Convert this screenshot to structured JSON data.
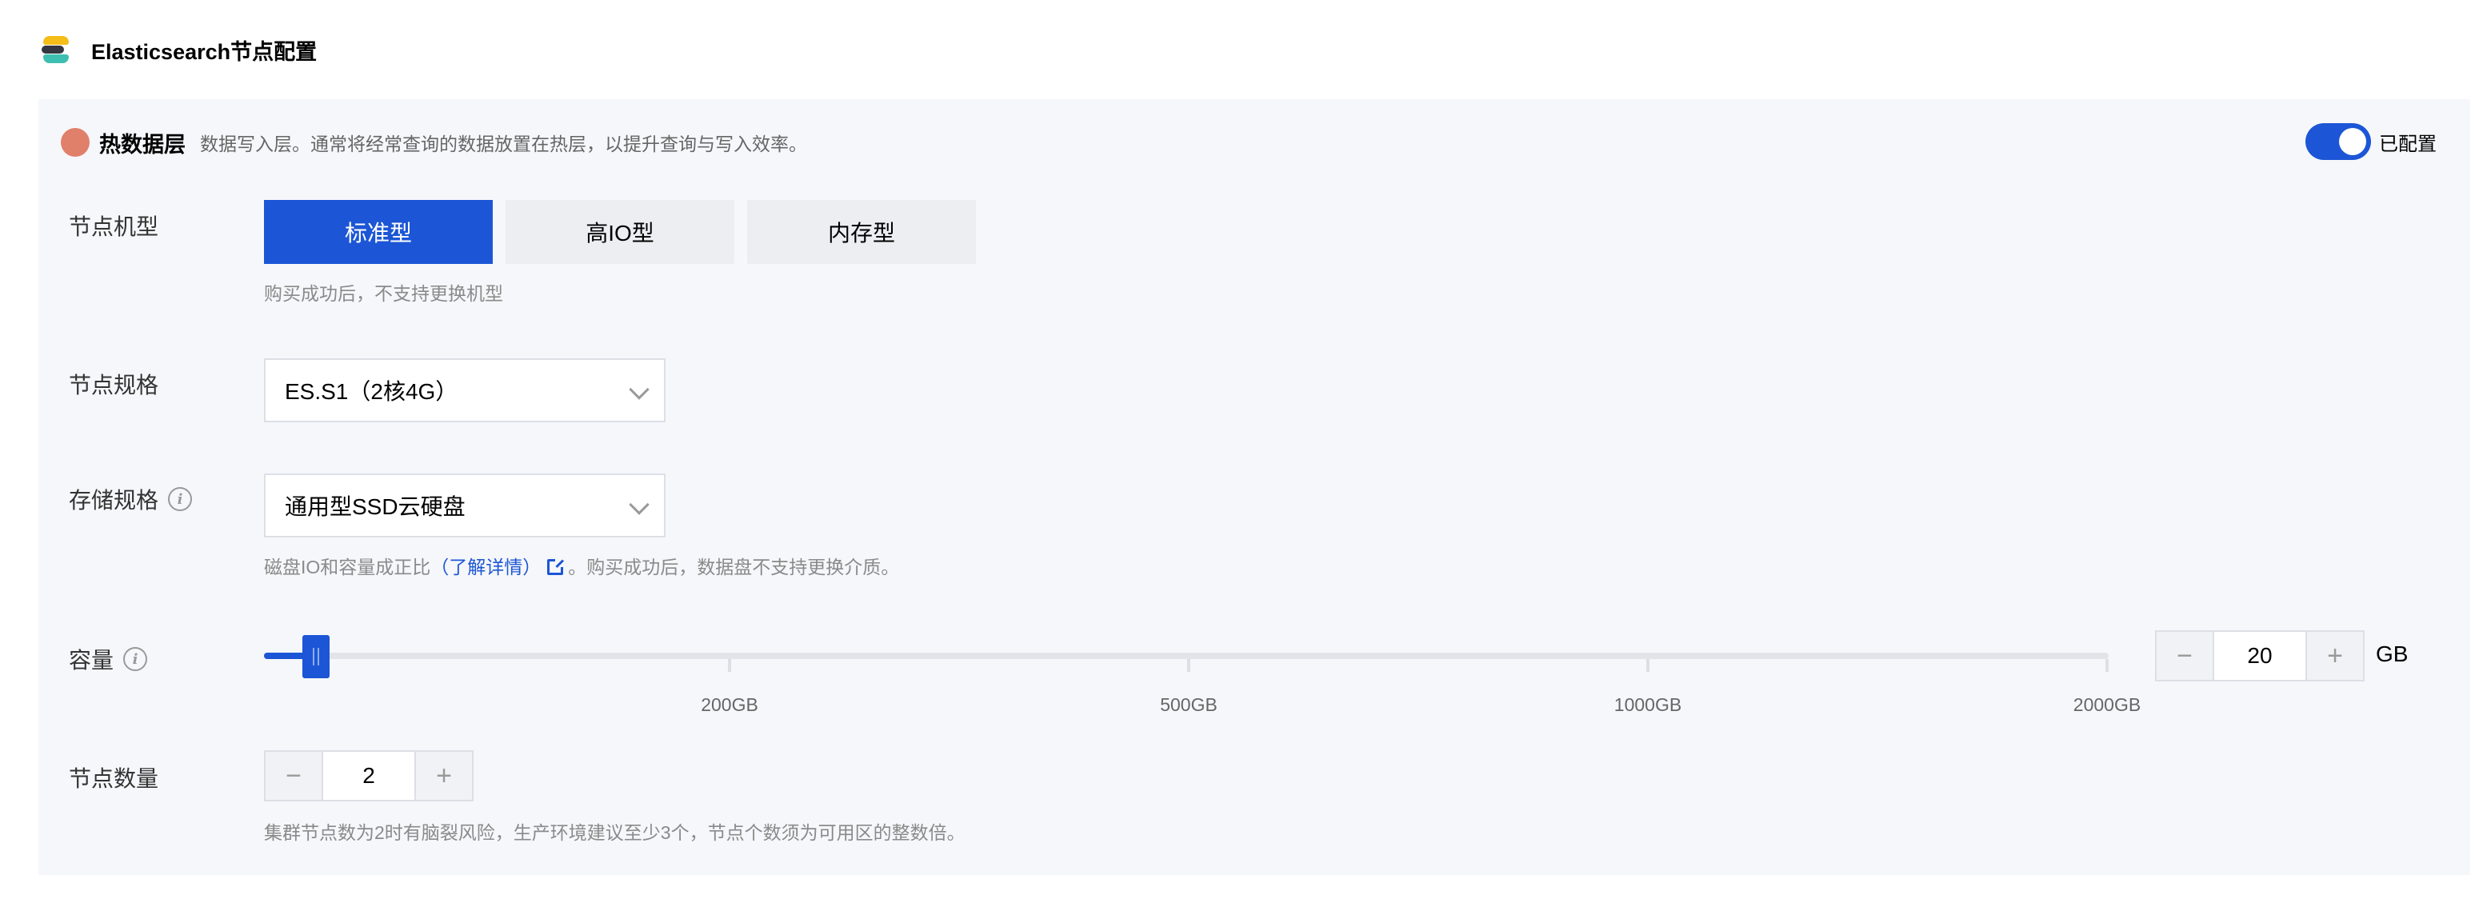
{
  "header": {
    "title": "Elasticsearch节点配置",
    "logo_icon": "elasticsearch-logo"
  },
  "tier": {
    "name": "热数据层",
    "description": "数据写入层。通常将经常查询的数据放置在热层，以提升查询与写入效率。",
    "dot_color": "#e07f6a",
    "toggle_on": true,
    "toggle_label": "已配置"
  },
  "node_type": {
    "label": "节点机型",
    "options": [
      "标准型",
      "高IO型",
      "内存型"
    ],
    "selected": "标准型",
    "hint": "购买成功后，不支持更换机型"
  },
  "node_spec": {
    "label": "节点规格",
    "value": "ES.S1（2核4G）"
  },
  "storage": {
    "label": "存储规格",
    "value": "通用型SSD云硬盘",
    "hint_prefix": "磁盘IO和容量成正比",
    "hint_link": "（了解详情）",
    "hint_suffix": "。购买成功后，数据盘不支持更换介质。"
  },
  "capacity": {
    "label": "容量",
    "value": "20",
    "unit": "GB",
    "minus": "−",
    "plus": "+",
    "ticks": [
      "200GB",
      "500GB",
      "1000GB",
      "2000GB"
    ]
  },
  "node_count": {
    "label": "节点数量",
    "value": "2",
    "minus": "−",
    "plus": "+",
    "hint": "集群节点数为2时有脑裂风险，生产环境建议至少3个，节点个数须为可用区的整数倍。"
  },
  "colors": {
    "accent": "#1c56d6",
    "panel_bg": "#f6f7fa"
  }
}
